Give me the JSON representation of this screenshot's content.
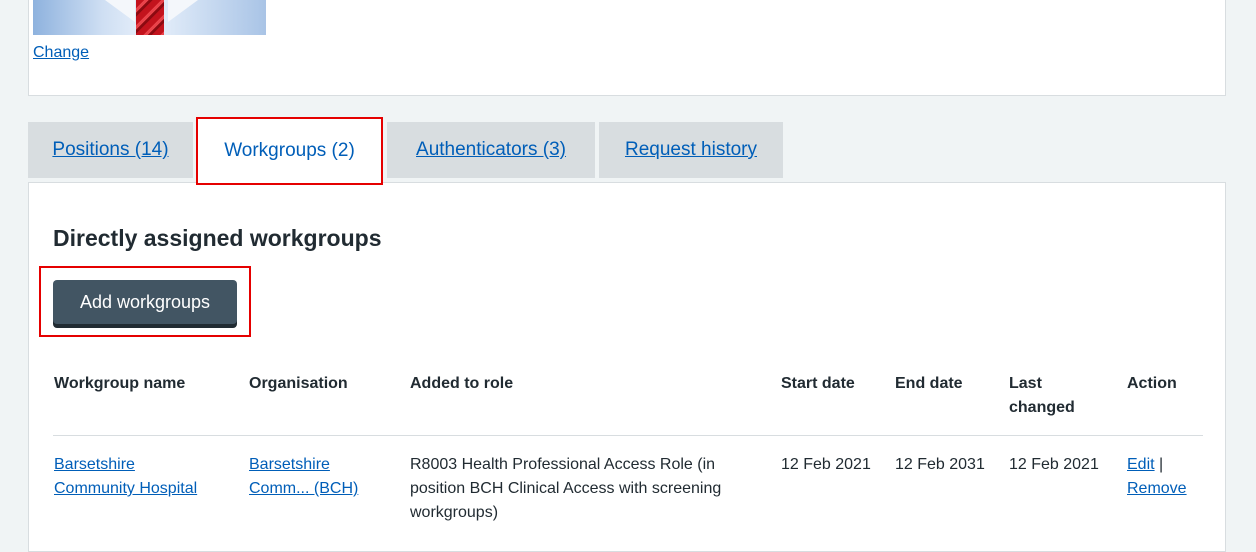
{
  "profile": {
    "change_link": "Change"
  },
  "tabs": [
    {
      "label": "Positions (14)"
    },
    {
      "label": "Workgroups (2)",
      "active": true
    },
    {
      "label": "Authenticators (3)"
    },
    {
      "label": "Request history"
    }
  ],
  "section": {
    "heading": "Directly assigned workgroups",
    "add_button": "Add workgroups"
  },
  "table": {
    "headers": {
      "name": "Workgroup name",
      "organisation": "Organisation",
      "added_to_role": "Added to role",
      "start_date": "Start date",
      "end_date": "End date",
      "last_changed_1": "Last",
      "last_changed_2": "changed",
      "action": "Action"
    },
    "rows": [
      {
        "name_1": "Barsetshire",
        "name_2": "Community Hospital",
        "org_1": "Barsetshire",
        "org_2": "Comm... (BCH)",
        "role_1": "R8003 Health Professional Access Role (in",
        "role_2": "position BCH Clinical Access with screening",
        "role_3": "workgroups)",
        "start_date": "12 Feb 2021",
        "end_date": "12 Feb 2031",
        "last_changed": "12 Feb 2021",
        "edit": "Edit",
        "separator": "|",
        "remove": "Remove"
      }
    ]
  },
  "colors": {
    "link": "#005eb8",
    "highlight": "#e50000",
    "button": "#425563",
    "background": "#f0f4f5"
  }
}
